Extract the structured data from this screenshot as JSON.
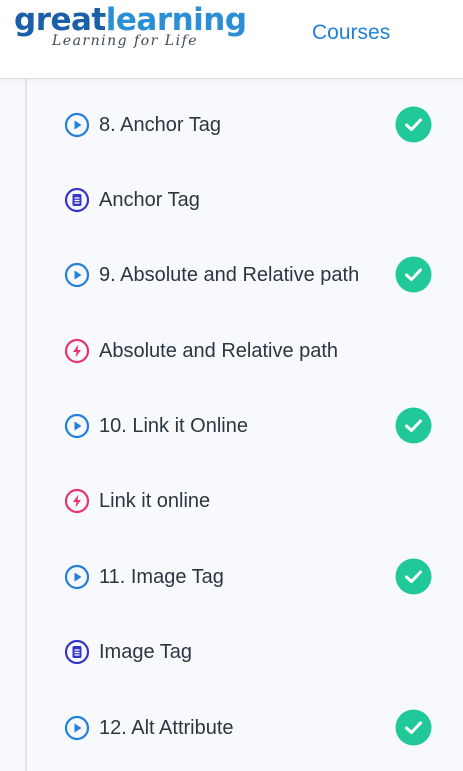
{
  "header": {
    "logo": {
      "part1": "great",
      "part2": "learning",
      "tagline": "Learning for Life"
    },
    "courses_label": "Courses"
  },
  "colors": {
    "video_icon": "#1f7fd9",
    "quiz_icon": "#3535c8",
    "exercise_icon": "#e6346f",
    "completed_check": "#20c997"
  },
  "items": [
    {
      "label": "8. Anchor Tag",
      "icon": "play-icon",
      "completed": true
    },
    {
      "label": "Anchor Tag",
      "icon": "quiz-icon",
      "completed": false
    },
    {
      "label": "9. Absolute and Relative path",
      "icon": "play-icon",
      "completed": true
    },
    {
      "label": "Absolute and Relative path",
      "icon": "bolt-icon",
      "completed": false
    },
    {
      "label": "10. Link it Online",
      "icon": "play-icon",
      "completed": true
    },
    {
      "label": "Link it online",
      "icon": "bolt-icon",
      "completed": false
    },
    {
      "label": "11. Image Tag",
      "icon": "play-icon",
      "completed": true
    },
    {
      "label": "Image Tag",
      "icon": "quiz-icon",
      "completed": false
    },
    {
      "label": "12. Alt Attribute",
      "icon": "play-icon",
      "completed": true
    }
  ]
}
